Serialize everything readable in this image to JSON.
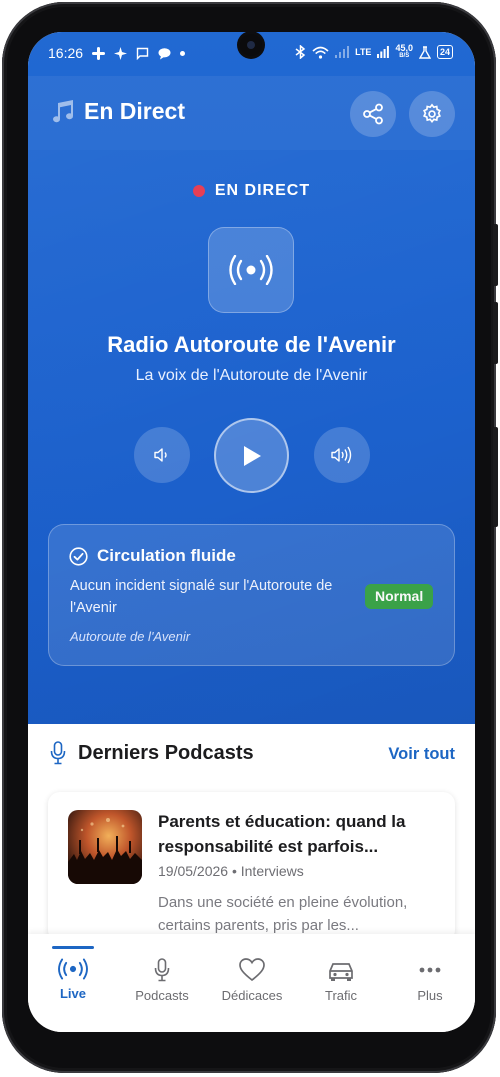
{
  "status_bar": {
    "time": "16:26",
    "network_speed_value": "45,0",
    "network_speed_unit": "B/S",
    "network_type": "LTE",
    "battery": "24"
  },
  "app_bar": {
    "title": "En Direct",
    "title_icon": "music-note-icon",
    "share_icon": "share-icon",
    "settings_icon": "gear-icon"
  },
  "live": {
    "badge_label": "EN DIRECT",
    "badge_color": "#e53950",
    "station_icon": "broadcast-icon",
    "station_name": "Radio Autoroute de l'Avenir",
    "station_tagline": "La voix de l'Autoroute de l'Avenir",
    "controls": {
      "volume_down_icon": "volume-down-icon",
      "play_icon": "play-icon",
      "volume_up_icon": "volume-up-icon"
    }
  },
  "traffic": {
    "title": "Circulation fluide",
    "status_icon": "check-circle-icon",
    "description": "Aucun incident signalé sur l'Autoroute de l'Avenir",
    "badge": "Normal",
    "badge_color": "#3ca64a",
    "route": "Autoroute de l'Avenir"
  },
  "podcasts": {
    "section_title": "Derniers Podcasts",
    "section_icon": "microphone-icon",
    "see_all": "Voir tout",
    "items": [
      {
        "title": "Parents et éducation: quand la responsabilité est parfois...",
        "date": "19/05/2026",
        "category": "Interviews",
        "meta": "19/05/2026 • Interviews",
        "excerpt": "Dans une société en pleine évolution, certains parents, pris par les..."
      }
    ]
  },
  "bottom_nav": {
    "active_color": "#1d66c3",
    "items": [
      {
        "label": "Live",
        "icon": "broadcast-icon",
        "active": true
      },
      {
        "label": "Podcasts",
        "icon": "microphone-icon",
        "active": false
      },
      {
        "label": "Dédicaces",
        "icon": "heart-icon",
        "active": false
      },
      {
        "label": "Trafic",
        "icon": "car-icon",
        "active": false
      },
      {
        "label": "Plus",
        "icon": "more-dots-icon",
        "active": false
      }
    ]
  },
  "colors": {
    "hero_blue": "#1f66d0",
    "link_blue": "#1d66c3"
  }
}
